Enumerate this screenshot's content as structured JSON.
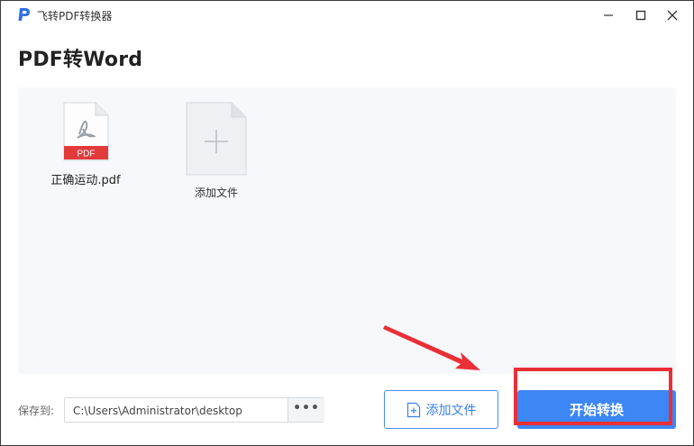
{
  "app": {
    "title": "飞转PDF转换器",
    "logo_letter": "P"
  },
  "page": {
    "title": "PDF转Word"
  },
  "files": {
    "items": [
      {
        "name": "正确运动.pdf",
        "badge": "PDF"
      }
    ],
    "add_label": "添加文件"
  },
  "footer": {
    "save_label": "保存到:",
    "save_path": "C:\\Users\\Administrator\\desktop",
    "browse_label": "•••",
    "add_file_label": "添加文件",
    "start_label": "开始转换"
  },
  "colors": {
    "accent": "#3d86f5",
    "pdf_red": "#e23b3b",
    "annotation_red": "#ea2f36"
  },
  "icons": [
    "app-logo-icon",
    "minimize-icon",
    "maximize-icon",
    "close-icon",
    "pdf-file-icon",
    "add-file-plus-icon",
    "add-document-icon"
  ]
}
